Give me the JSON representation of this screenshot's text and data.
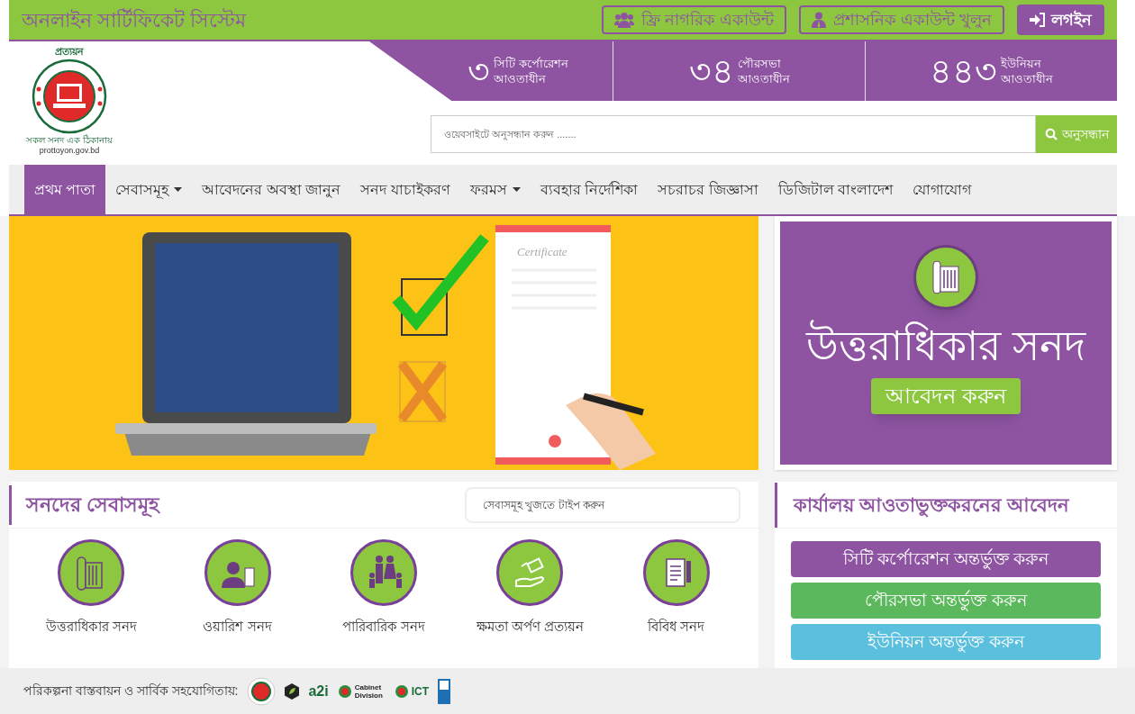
{
  "top_bar": {
    "title": "অনলাইন সার্টিফিকেট সিস্টেম",
    "buttons": [
      {
        "kind": "citizen",
        "label": "ফ্রি নাগরিক একাউন্ট"
      },
      {
        "kind": "admin",
        "label": "প্রশাসনিক একাউন্ট খুলুন"
      },
      {
        "kind": "login",
        "label": "লগইন"
      }
    ]
  },
  "logo": {
    "title": "প্রত্যয়ন",
    "motto": "সকল সনদ এক ঠিকানায়",
    "url": "prottoyon.gov.bd"
  },
  "stats": [
    {
      "number": "৩",
      "label": "সিটি কর্পোরেশন",
      "sub": "আওতাধীন"
    },
    {
      "number": "৩৪",
      "label": "পৌরসভা",
      "sub": "আওতাধীন"
    },
    {
      "number": "৪৪৩",
      "label": "ইউনিয়ন",
      "sub": "আওতাধীন"
    }
  ],
  "search": {
    "placeholder": "ওয়েবসাইটে অনুসন্ধান করুন .......",
    "button": "অনুসন্ধান"
  },
  "nav": [
    {
      "label": "প্রথম পাতা",
      "selected": true,
      "dropdown": false
    },
    {
      "label": "সেবাসমূহ",
      "selected": false,
      "dropdown": true
    },
    {
      "label": "আবেদনের অবস্থা জানুন",
      "selected": false,
      "dropdown": false
    },
    {
      "label": "সনদ যাচাইকরণ",
      "selected": false,
      "dropdown": false
    },
    {
      "label": "ফরমস",
      "selected": false,
      "dropdown": true
    },
    {
      "label": "ব্যবহার নির্দেশিকা",
      "selected": false,
      "dropdown": false
    },
    {
      "label": "সচরাচর জিজ্ঞাসা",
      "selected": false,
      "dropdown": false
    },
    {
      "label": "ডিজিটাল বাংলাদেশ",
      "selected": false,
      "dropdown": false
    },
    {
      "label": "যোগাযোগ",
      "selected": false,
      "dropdown": false
    }
  ],
  "banner": {
    "certificate_label": "Certificate"
  },
  "promo": {
    "title": "উত্তরাধিকার সনদ",
    "button": "আবেদন করুন"
  },
  "services": {
    "title": "সনদের সেবাসমূহ",
    "search_placeholder": "সেবাসমূহ খুজতে টাইপ করুন",
    "items": [
      {
        "kind": "scroll",
        "label": "উত্তরাধিকার সনদ"
      },
      {
        "kind": "person",
        "label": "ওয়ারিশ সনদ"
      },
      {
        "kind": "family",
        "label": "পারিবারিক সনদ"
      },
      {
        "kind": "hand",
        "label": "ক্ষমতা অর্পণ প্রত্যয়ন"
      },
      {
        "kind": "document",
        "label": "বিবিধ সনদ"
      }
    ]
  },
  "office": {
    "title": "কার্যালয় আওতাভুক্তকরনের আবেদন",
    "buttons": [
      {
        "label": "সিটি কর্পোরেশন অন্তর্ভুক্ত করুন",
        "color": "#8e54a2"
      },
      {
        "label": "পৌরসভা অন্তর্ভুক্ত করুন",
        "color": "#5cb85c"
      },
      {
        "label": "ইউনিয়ন অন্তর্ভুক্ত করুন",
        "color": "#5bc0de"
      }
    ]
  },
  "footer": {
    "label": "পরিকল্পনা বাস্তবায়ন ও সার্বিক সহযোগিতায়:",
    "partners": [
      {
        "kind": "seal"
      },
      {
        "kind": "leaf"
      },
      {
        "kind": "a2i",
        "text": "a2i"
      },
      {
        "kind": "cabinet",
        "text": "Cabinet Division"
      },
      {
        "kind": "ict",
        "text": "ICT"
      },
      {
        "kind": "undp"
      }
    ]
  }
}
